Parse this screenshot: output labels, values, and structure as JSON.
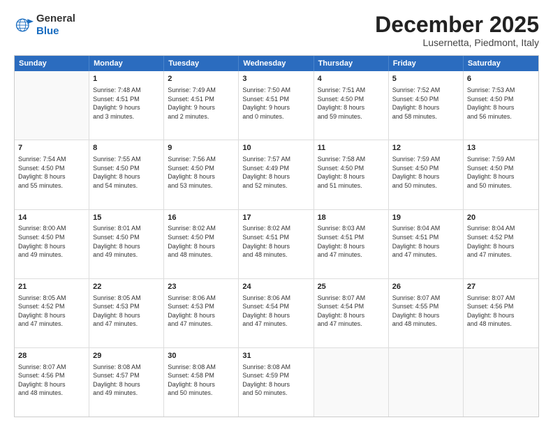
{
  "logo": {
    "line1": "General",
    "line2": "Blue"
  },
  "title": "December 2025",
  "subtitle": "Lusernetta, Piedmont, Italy",
  "header_days": [
    "Sunday",
    "Monday",
    "Tuesday",
    "Wednesday",
    "Thursday",
    "Friday",
    "Saturday"
  ],
  "weeks": [
    [
      {
        "day": "",
        "text": ""
      },
      {
        "day": "1",
        "text": "Sunrise: 7:48 AM\nSunset: 4:51 PM\nDaylight: 9 hours\nand 3 minutes."
      },
      {
        "day": "2",
        "text": "Sunrise: 7:49 AM\nSunset: 4:51 PM\nDaylight: 9 hours\nand 2 minutes."
      },
      {
        "day": "3",
        "text": "Sunrise: 7:50 AM\nSunset: 4:51 PM\nDaylight: 9 hours\nand 0 minutes."
      },
      {
        "day": "4",
        "text": "Sunrise: 7:51 AM\nSunset: 4:50 PM\nDaylight: 8 hours\nand 59 minutes."
      },
      {
        "day": "5",
        "text": "Sunrise: 7:52 AM\nSunset: 4:50 PM\nDaylight: 8 hours\nand 58 minutes."
      },
      {
        "day": "6",
        "text": "Sunrise: 7:53 AM\nSunset: 4:50 PM\nDaylight: 8 hours\nand 56 minutes."
      }
    ],
    [
      {
        "day": "7",
        "text": "Sunrise: 7:54 AM\nSunset: 4:50 PM\nDaylight: 8 hours\nand 55 minutes."
      },
      {
        "day": "8",
        "text": "Sunrise: 7:55 AM\nSunset: 4:50 PM\nDaylight: 8 hours\nand 54 minutes."
      },
      {
        "day": "9",
        "text": "Sunrise: 7:56 AM\nSunset: 4:50 PM\nDaylight: 8 hours\nand 53 minutes."
      },
      {
        "day": "10",
        "text": "Sunrise: 7:57 AM\nSunset: 4:49 PM\nDaylight: 8 hours\nand 52 minutes."
      },
      {
        "day": "11",
        "text": "Sunrise: 7:58 AM\nSunset: 4:50 PM\nDaylight: 8 hours\nand 51 minutes."
      },
      {
        "day": "12",
        "text": "Sunrise: 7:59 AM\nSunset: 4:50 PM\nDaylight: 8 hours\nand 50 minutes."
      },
      {
        "day": "13",
        "text": "Sunrise: 7:59 AM\nSunset: 4:50 PM\nDaylight: 8 hours\nand 50 minutes."
      }
    ],
    [
      {
        "day": "14",
        "text": "Sunrise: 8:00 AM\nSunset: 4:50 PM\nDaylight: 8 hours\nand 49 minutes."
      },
      {
        "day": "15",
        "text": "Sunrise: 8:01 AM\nSunset: 4:50 PM\nDaylight: 8 hours\nand 49 minutes."
      },
      {
        "day": "16",
        "text": "Sunrise: 8:02 AM\nSunset: 4:50 PM\nDaylight: 8 hours\nand 48 minutes."
      },
      {
        "day": "17",
        "text": "Sunrise: 8:02 AM\nSunset: 4:51 PM\nDaylight: 8 hours\nand 48 minutes."
      },
      {
        "day": "18",
        "text": "Sunrise: 8:03 AM\nSunset: 4:51 PM\nDaylight: 8 hours\nand 47 minutes."
      },
      {
        "day": "19",
        "text": "Sunrise: 8:04 AM\nSunset: 4:51 PM\nDaylight: 8 hours\nand 47 minutes."
      },
      {
        "day": "20",
        "text": "Sunrise: 8:04 AM\nSunset: 4:52 PM\nDaylight: 8 hours\nand 47 minutes."
      }
    ],
    [
      {
        "day": "21",
        "text": "Sunrise: 8:05 AM\nSunset: 4:52 PM\nDaylight: 8 hours\nand 47 minutes."
      },
      {
        "day": "22",
        "text": "Sunrise: 8:05 AM\nSunset: 4:53 PM\nDaylight: 8 hours\nand 47 minutes."
      },
      {
        "day": "23",
        "text": "Sunrise: 8:06 AM\nSunset: 4:53 PM\nDaylight: 8 hours\nand 47 minutes."
      },
      {
        "day": "24",
        "text": "Sunrise: 8:06 AM\nSunset: 4:54 PM\nDaylight: 8 hours\nand 47 minutes."
      },
      {
        "day": "25",
        "text": "Sunrise: 8:07 AM\nSunset: 4:54 PM\nDaylight: 8 hours\nand 47 minutes."
      },
      {
        "day": "26",
        "text": "Sunrise: 8:07 AM\nSunset: 4:55 PM\nDaylight: 8 hours\nand 48 minutes."
      },
      {
        "day": "27",
        "text": "Sunrise: 8:07 AM\nSunset: 4:56 PM\nDaylight: 8 hours\nand 48 minutes."
      }
    ],
    [
      {
        "day": "28",
        "text": "Sunrise: 8:07 AM\nSunset: 4:56 PM\nDaylight: 8 hours\nand 48 minutes."
      },
      {
        "day": "29",
        "text": "Sunrise: 8:08 AM\nSunset: 4:57 PM\nDaylight: 8 hours\nand 49 minutes."
      },
      {
        "day": "30",
        "text": "Sunrise: 8:08 AM\nSunset: 4:58 PM\nDaylight: 8 hours\nand 50 minutes."
      },
      {
        "day": "31",
        "text": "Sunrise: 8:08 AM\nSunset: 4:59 PM\nDaylight: 8 hours\nand 50 minutes."
      },
      {
        "day": "",
        "text": ""
      },
      {
        "day": "",
        "text": ""
      },
      {
        "day": "",
        "text": ""
      }
    ]
  ]
}
